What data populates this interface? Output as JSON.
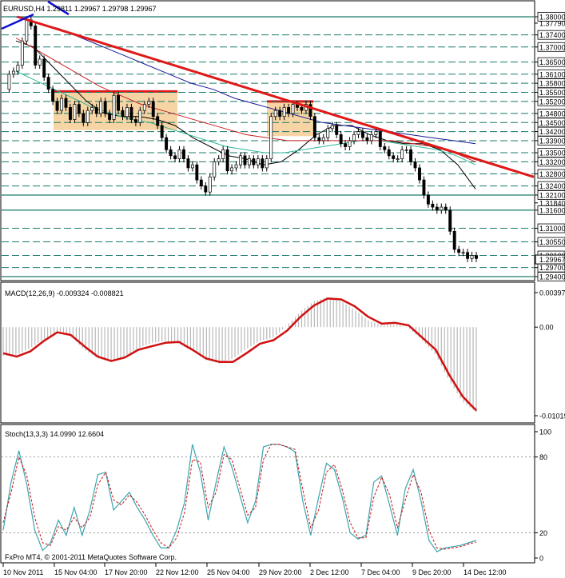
{
  "chart_data": [
    {
      "panel": "price",
      "type": "candlestick",
      "header": "EURUSD,H4  1.29811 1.29967 1.29798 1.29967",
      "price_ticks": [
        "1.38000",
        "1.37790",
        "1.37400",
        "1.37000",
        "1.36500",
        "1.36100",
        "1.35800",
        "1.35500",
        "1.35200",
        "1.34800",
        "1.34500",
        "1.34200",
        "1.33900",
        "1.33500",
        "1.33200",
        "1.32800",
        "1.32400",
        "1.32100",
        "1.31840",
        "1.31600",
        "1.31000",
        "1.30550",
        "1.30100",
        "1.29700",
        "1.29400"
      ],
      "ylim": [
        1.294,
        1.38
      ],
      "current_price": "1.29967",
      "horizontal_levels": [
        1.38,
        1.374,
        1.37,
        1.365,
        1.361,
        1.358,
        1.355,
        1.352,
        1.348,
        1.345,
        1.342,
        1.339,
        1.335,
        1.332,
        1.328,
        1.324,
        1.321,
        1.316,
        1.31,
        1.3055,
        1.301,
        1.297,
        1.294
      ],
      "close_path": [
        1.356,
        1.361,
        1.362,
        1.364,
        1.372,
        1.379,
        1.377,
        1.364,
        1.366,
        1.36,
        1.356,
        1.352,
        1.349,
        1.353,
        1.35,
        1.346,
        1.351,
        1.348,
        1.345,
        1.349,
        1.35,
        1.348,
        1.352,
        1.348,
        1.346,
        1.354,
        1.349,
        1.347,
        1.35,
        1.346,
        1.345,
        1.349,
        1.351,
        1.352,
        1.347,
        1.344,
        1.34,
        1.336,
        1.334,
        1.333,
        1.336,
        1.333,
        1.33,
        1.331,
        1.326,
        1.324,
        1.322,
        1.327,
        1.332,
        1.333,
        1.336,
        1.329,
        1.33,
        1.331,
        1.334,
        1.331,
        1.333,
        1.331,
        1.333,
        1.33,
        1.333,
        1.347,
        1.349,
        1.347,
        1.35,
        1.348,
        1.351,
        1.35,
        1.349,
        1.351,
        1.347,
        1.34,
        1.339,
        1.34,
        1.343,
        1.344,
        1.341,
        1.338,
        1.337,
        1.339,
        1.341,
        1.342,
        1.34,
        1.339,
        1.341,
        1.342,
        1.337,
        1.336,
        1.334,
        1.333,
        1.333,
        1.336,
        1.336,
        1.332,
        1.33,
        1.326,
        1.321,
        1.318,
        1.317,
        1.316,
        1.317,
        1.316,
        1.309,
        1.303,
        1.302,
        1.302,
        1.3,
        1.301,
        1.3
      ],
      "trendline": {
        "start": 1.38,
        "end": 1.327
      },
      "moving_averages": [
        {
          "color": "#000000",
          "values": [
            1.372,
            1.37,
            1.364,
            1.358,
            1.352,
            1.348,
            1.347,
            1.347,
            1.346,
            1.344,
            1.34,
            1.337,
            1.334,
            1.333,
            1.331,
            1.332,
            1.336,
            1.341,
            1.344,
            1.344,
            1.341,
            1.339,
            1.338,
            1.338,
            1.336,
            1.331,
            1.323
          ]
        },
        {
          "color": "#2eb89a",
          "values": [
            1.362,
            1.359,
            1.356,
            1.353,
            1.35,
            1.348,
            1.346,
            1.345,
            1.343,
            1.341,
            1.339,
            1.337,
            1.336,
            1.335,
            1.335,
            1.336,
            1.337,
            1.338,
            1.339,
            1.339,
            1.338,
            1.337,
            1.336,
            1.334,
            1.331
          ]
        },
        {
          "color": "#cc2222",
          "values": [
            1.373,
            1.369,
            1.365,
            1.361,
            1.357,
            1.354,
            1.351,
            1.349,
            1.347,
            1.345,
            1.343,
            1.341,
            1.34,
            1.339,
            1.339,
            1.339,
            1.339,
            1.339,
            1.339,
            1.338,
            1.337,
            1.335,
            1.332
          ]
        },
        {
          "color": "#1a1a99",
          "values": [
            1.38,
            1.378,
            1.376,
            1.373,
            1.37,
            1.367,
            1.364,
            1.361,
            1.358,
            1.356,
            1.353,
            1.351,
            1.349,
            1.347,
            1.345,
            1.344,
            1.343,
            1.342,
            1.341,
            1.34,
            1.339,
            1.338
          ]
        }
      ],
      "consolidation_boxes": [
        {
          "top": 1.3553,
          "bottom": 1.3425,
          "fill": "#f6d4a4"
        },
        {
          "top": 1.352,
          "bottom": 1.3405,
          "fill": "#f6d4a4"
        }
      ]
    },
    {
      "panel": "macd",
      "type": "line",
      "label": "MACD(12,26,9) -0.009324 -0.008821",
      "y_ticks": [
        "0.003978",
        "0.00",
        "-0.010199"
      ],
      "ylim": [
        -0.010199,
        0.003978
      ],
      "signal": [
        -0.003,
        -0.0034,
        -0.0028,
        -0.0016,
        -0.0006,
        -0.0009,
        -0.0022,
        -0.0034,
        -0.0039,
        -0.0035,
        -0.0026,
        -0.0022,
        -0.0018,
        -0.0017,
        -0.0026,
        -0.0036,
        -0.004,
        -0.004,
        -0.003,
        -0.0019,
        -0.0015,
        -0.0004,
        0.0012,
        0.0025,
        0.0033,
        0.0032,
        0.0024,
        0.0012,
        0.0004,
        0.0005,
        0.0002,
        -0.0012,
        -0.0026,
        -0.0055,
        -0.008,
        -0.0096
      ],
      "histogram": [
        -0.0033,
        -0.0032,
        -0.0024,
        -0.0014,
        -0.0006,
        -0.001,
        -0.0026,
        -0.0036,
        -0.004,
        -0.0034,
        -0.0024,
        -0.0018,
        -0.0016,
        -0.0019,
        -0.0028,
        -0.0038,
        -0.0042,
        -0.0036,
        -0.0025,
        -0.0016,
        -0.0012,
        0.0002,
        0.0018,
        0.003,
        0.0034,
        0.003,
        0.002,
        0.0008,
        0.0002,
        0.0003,
        -0.0001,
        -0.0015,
        -0.0032,
        -0.0062,
        -0.0086,
        -0.0098
      ]
    },
    {
      "panel": "stochastic",
      "type": "line",
      "label": "Stoch(13,3,3) 14.0990 12.6604",
      "y_ticks": [
        "100",
        "80",
        "20",
        "0"
      ],
      "ylim": [
        0,
        100
      ],
      "main": [
        22,
        60,
        85,
        58,
        22,
        6,
        12,
        30,
        18,
        40,
        18,
        38,
        66,
        68,
        38,
        45,
        52,
        40,
        30,
        18,
        8,
        8,
        22,
        44,
        90,
        68,
        30,
        60,
        88,
        72,
        50,
        28,
        45,
        88,
        90,
        90,
        88,
        84,
        45,
        18,
        48,
        75,
        70,
        48,
        20,
        15,
        18,
        60,
        65,
        42,
        18,
        55,
        70,
        45,
        14,
        5,
        8,
        9,
        10,
        12,
        14
      ],
      "signal": [
        28,
        52,
        80,
        65,
        32,
        12,
        10,
        25,
        22,
        32,
        24,
        32,
        58,
        68,
        46,
        42,
        50,
        44,
        34,
        22,
        12,
        8,
        16,
        36,
        78,
        76,
        40,
        52,
        82,
        78,
        56,
        34,
        40,
        78,
        90,
        90,
        88,
        86,
        54,
        24,
        38,
        68,
        74,
        54,
        28,
        16,
        16,
        48,
        64,
        50,
        24,
        46,
        66,
        52,
        22,
        8,
        7,
        8,
        9,
        11,
        12.7
      ]
    }
  ],
  "x_axis_labels": [
    "10 Nov 2011",
    "15 Nov 04:00",
    "17 Nov 20:00",
    "22 Nov 12:00",
    "25 Nov 04:00",
    "29 Nov 20:00",
    "2 Dec 12:00",
    "7 Dec 04:00",
    "9 Dec 20:00",
    "14 Dec 12:00"
  ],
  "copyright": "FxPro MT4, © 2001-2011 MetaQuotes Software Corp.",
  "colors": {
    "candle": "#000000",
    "grid_dash": "#1a7a6a",
    "grid_solid": "#1a7a6a",
    "trendline": "#e01818",
    "macd_signal": "#d01010",
    "macd_hist": "#b8b8b8",
    "stoch_main": "#3aa6b0",
    "stoch_signal": "#d01010",
    "blue_line": "#1010d0"
  }
}
